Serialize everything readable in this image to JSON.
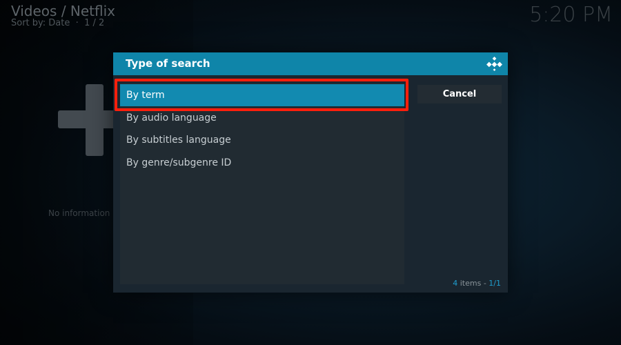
{
  "header": {
    "title": "Videos / Netflix",
    "sort_label": "Sort by: Date",
    "page": "1 / 2"
  },
  "clock": "5:20 PM",
  "background": {
    "no_info_text": "No information a"
  },
  "dialog": {
    "title": "Type of search",
    "items": [
      {
        "label": "By term",
        "selected": true
      },
      {
        "label": "By audio language",
        "selected": false
      },
      {
        "label": "By subtitles language",
        "selected": false
      },
      {
        "label": "By genre/subgenre ID",
        "selected": false
      }
    ],
    "cancel_label": "Cancel",
    "count": {
      "number": "4",
      "unit": "items",
      "separator": " - ",
      "page": "1/1"
    }
  },
  "icons": {
    "add": "plus-icon",
    "logo": "kodi-logo-icon"
  },
  "colors": {
    "accent": "#128ab0",
    "header_bar": "#0f85a9",
    "highlight_box": "#ff1f0c",
    "count_accent": "#1f9fd0"
  }
}
